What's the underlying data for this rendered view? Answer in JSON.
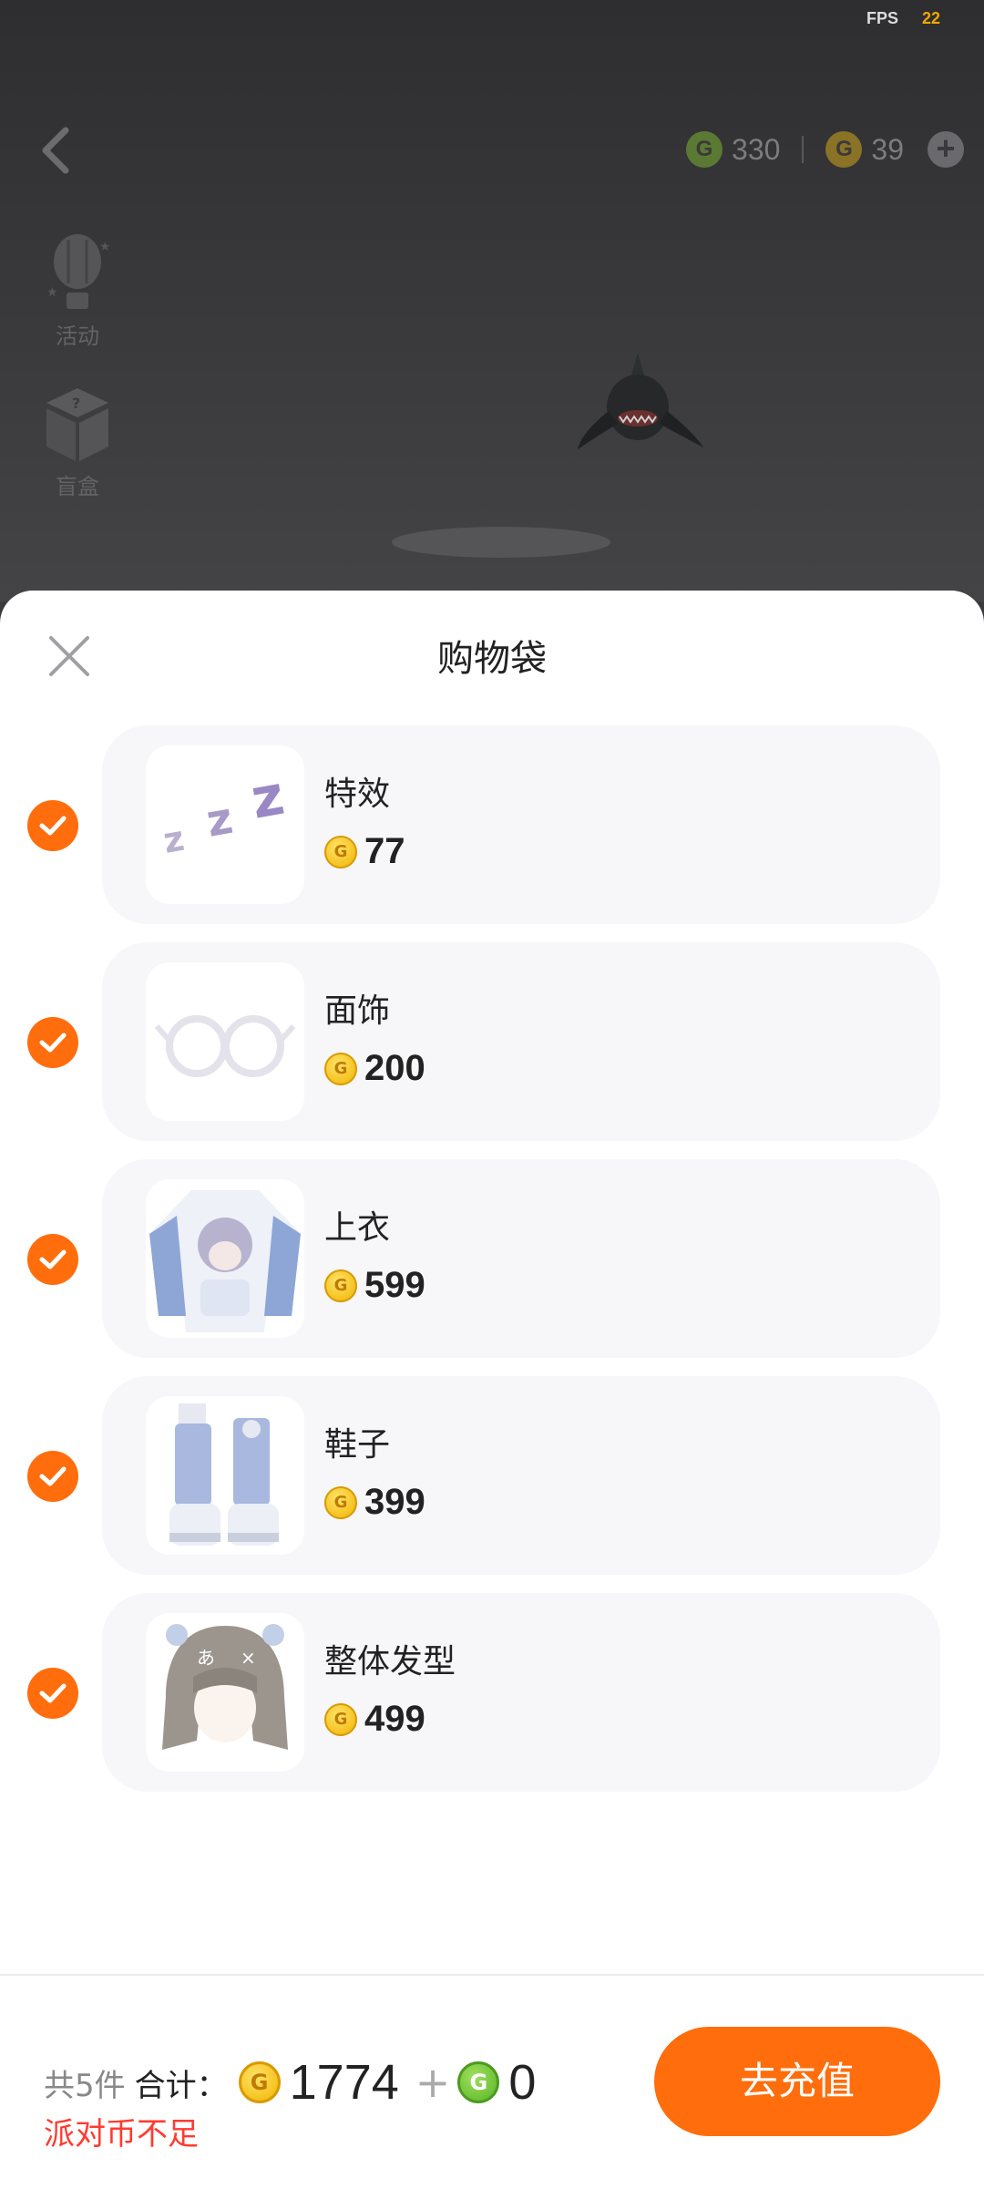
{
  "status": {
    "fps_label": "FPS",
    "fps_value": "22"
  },
  "header": {
    "green_currency": "330",
    "gold_currency": "39"
  },
  "side_menu": [
    {
      "label": "活动",
      "icon": "hot-air-balloon-icon"
    },
    {
      "label": "盲盒",
      "icon": "mystery-box-icon"
    }
  ],
  "sheet": {
    "title": "购物袋",
    "items": [
      {
        "name": "特效",
        "price": "77",
        "checked": true,
        "icon": "zzz-effect-icon"
      },
      {
        "name": "面饰",
        "price": "200",
        "checked": true,
        "icon": "glasses-icon"
      },
      {
        "name": "上衣",
        "price": "599",
        "checked": true,
        "icon": "sweater-icon"
      },
      {
        "name": "鞋子",
        "price": "399",
        "checked": true,
        "icon": "boots-icon"
      },
      {
        "name": "整体发型",
        "price": "499",
        "checked": true,
        "icon": "hairstyle-icon"
      }
    ]
  },
  "footer": {
    "count_text": "共5件",
    "total_label": "合计：",
    "gold_total": "1774",
    "plus": "+",
    "green_total": "0",
    "warning": "派对币不足",
    "recharge_button": "去充值"
  },
  "colors": {
    "accent": "#ff6d0c",
    "warning": "#ff3b30",
    "card_bg": "#f7f6f9"
  }
}
